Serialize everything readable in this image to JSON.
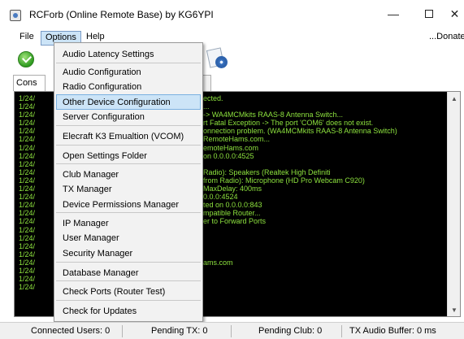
{
  "window": {
    "title": "RCForb (Online Remote Base) by KG6YPI",
    "minimize_glyph": "—",
    "close_glyph": "✕"
  },
  "menubar": {
    "file": "File",
    "options": "Options",
    "help": "Help",
    "donate": "...Donate"
  },
  "tabs": {
    "console": "Cons"
  },
  "options_menu": {
    "items": [
      "Audio Latency Settings",
      "Audio Configuration",
      "Radio Configuration",
      "Other Device Configuration",
      "Server Configuration",
      "Elecraft K3 Emualtion (VCOM)",
      "Open Settings Folder",
      "Club Manager",
      "TX Manager",
      "Device Permissions Manager",
      "IP Manager",
      "User Manager",
      "Security Manager",
      "Database Manager",
      "Check Ports (Router Test)",
      "Check for Updates"
    ],
    "highlighted": "Other Device Configuration"
  },
  "console": {
    "timestamp": "1/24/",
    "lines": [
      "ected.",
      "...",
      "-> WA4MCMkits RAAS-8 Antenna Switch...",
      "rt Fatal Exception -> The port 'COM6' does not exist.",
      "onnection problem. (WA4MCMkits RAAS-8 Antenna Switch)",
      "RemoteHams.com...",
      "emoteHams.com",
      "on 0.0.0.0:4525",
      "",
      "Radio): Speakers (Realtek High Definiti",
      "from Radio): Microphone (HD Pro Webcam C920)",
      "MaxDelay: 400ms",
      "0.0.0:4524",
      "ted on 0.0.0.0:843",
      "mpatible Router...",
      "er to Forward Ports",
      "",
      "",
      "",
      "",
      "ams.com",
      "",
      "",
      ""
    ]
  },
  "status": {
    "connected_users": "Connected Users: 0",
    "pending_tx": "Pending TX: 0",
    "pending_club": "Pending Club: 0",
    "tx_audio_buffer": "TX Audio Buffer: 0 ms"
  },
  "colors": {
    "console_bg": "#000000",
    "console_text": "#8de23e",
    "menu_highlight": "#cce4f7"
  }
}
